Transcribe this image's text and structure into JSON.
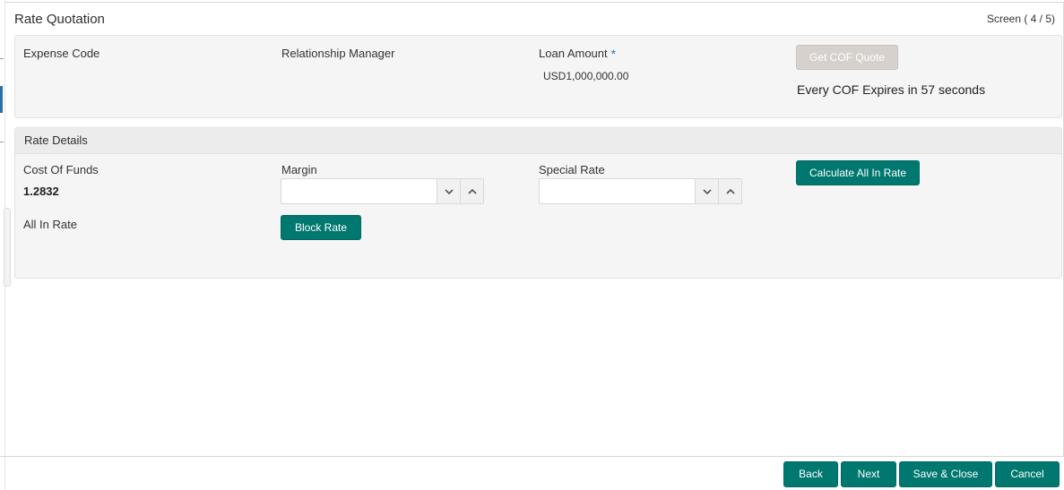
{
  "header": {
    "title": "Rate Quotation",
    "screen_indicator": "Screen ( 4 / 5)"
  },
  "quote_section": {
    "expense_code_label": "Expense Code",
    "relationship_manager_label": "Relationship Manager",
    "loan_amount_label": "Loan Amount",
    "required_marker": "*",
    "loan_amount_value": "USD1,000,000.00",
    "get_cof_quote_label": "Get COF Quote",
    "cof_expiry_text": "Every COF Expires in 57 seconds"
  },
  "rate_details": {
    "section_title": "Rate Details",
    "cost_of_funds_label": "Cost Of Funds",
    "cost_of_funds_value": "1.2832",
    "margin_label": "Margin",
    "margin_value": "",
    "special_rate_label": "Special Rate",
    "special_rate_value": "",
    "calculate_button_label": "Calculate All In Rate",
    "all_in_rate_label": "All In Rate",
    "block_rate_label": "Block Rate"
  },
  "footer": {
    "back_label": "Back",
    "next_label": "Next",
    "save_close_label": "Save & Close",
    "cancel_label": "Cancel"
  },
  "colors": {
    "primary_button": "#00786f",
    "disabled_button": "#d6d1cc",
    "required_star": "#2a7ab8"
  }
}
